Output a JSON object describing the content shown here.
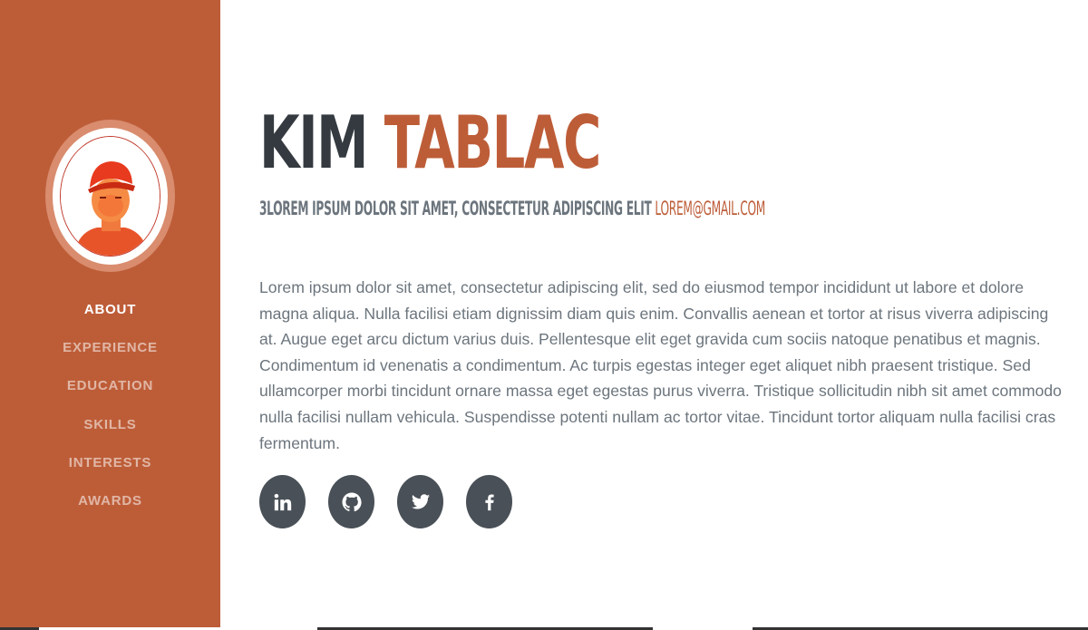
{
  "profile": {
    "first_name": "KIM",
    "last_name": "TABLAC",
    "subheading_text": "3LOREM IPSUM DOLOR SIT AMET, CONSECTETUR ADIPISCING ELIT",
    "email": "LOREM@GMAIL.COM",
    "about": "Lorem ipsum dolor sit amet, consectetur adipiscing elit, sed do eiusmod tempor incididunt ut labore et dolore magna aliqua. Nulla facilisi etiam dignissim diam quis enim. Convallis aenean et tortor at risus viverra adipiscing at. Augue eget arcu dictum varius duis. Pellentesque elit eget gravida cum sociis natoque penatibus et magnis. Condimentum id venenatis a condimentum. Ac turpis egestas integer eget aliquet nibh praesent tristique. Sed ullamcorper morbi tincidunt ornare massa eget egestas purus viverra. Tristique sollicitudin nibh sit amet commodo nulla facilisi nullam vehicula. Suspendisse potenti nullam ac tortor vitae. Tincidunt tortor aliquam nulla facilisi cras fermentum."
  },
  "sidebar": {
    "avatar_icon": "profile-photo",
    "nav": [
      {
        "label": "ABOUT",
        "active": true
      },
      {
        "label": "EXPERIENCE",
        "active": false
      },
      {
        "label": "EDUCATION",
        "active": false
      },
      {
        "label": "SKILLS",
        "active": false
      },
      {
        "label": "INTERESTS",
        "active": false
      },
      {
        "label": "AWARDS",
        "active": false
      }
    ]
  },
  "social": [
    {
      "icon": "linkedin-icon"
    },
    {
      "icon": "github-icon"
    },
    {
      "icon": "twitter-icon"
    },
    {
      "icon": "facebook-icon"
    }
  ],
  "colors": {
    "primary": "#bd5d38",
    "heading": "#343a40",
    "text": "#6c757d",
    "social_bg": "#495057"
  }
}
